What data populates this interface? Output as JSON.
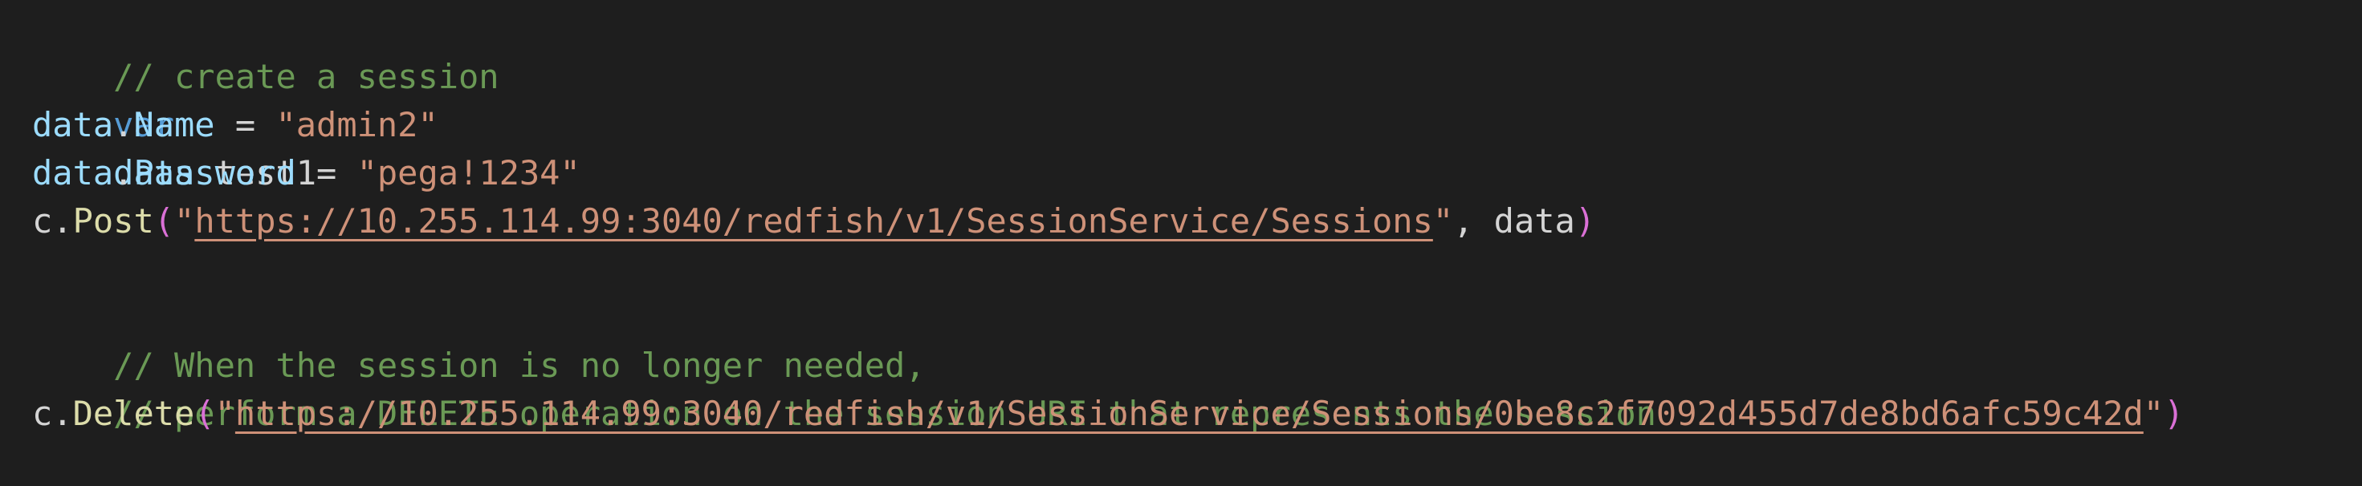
{
  "editor": {
    "line1": {
      "comment": "// create a session"
    },
    "line2": {
      "keyword": "var",
      "name": "data",
      "rest": " test1"
    },
    "line3": {
      "object": "data",
      "dot": ".",
      "prop": "Name",
      "op": " = ",
      "value": "\"admin2\""
    },
    "line4": {
      "object": "data",
      "dot": ".",
      "prop": "Password",
      "op": " = ",
      "value": "\"pega!1234\""
    },
    "line5": {
      "object": "c",
      "dot": ".",
      "method": "Post",
      "open_paren": "(",
      "quote_open": "\"",
      "url": "https://10.255.114.99:3040/redfish/v1/SessionService/Sessions",
      "quote_close": "\"",
      "args_rest": ", data",
      "close_paren": ")"
    },
    "line7": {
      "comment": "// When the session is no longer needed,"
    },
    "line8": {
      "comment": "// perform a DELETE operation on the session URI that represents the session"
    },
    "line9": {
      "object": "c",
      "dot": ".",
      "method": "Delete",
      "open_paren": "(",
      "quote_open": "\"",
      "url": "https://10.255.114.99:3040/redfish/v1/SessionService/Sessions/0be8c2f7092d455d7de8bd6afc59c42d",
      "quote_close": "\"",
      "close_paren": ")"
    }
  }
}
